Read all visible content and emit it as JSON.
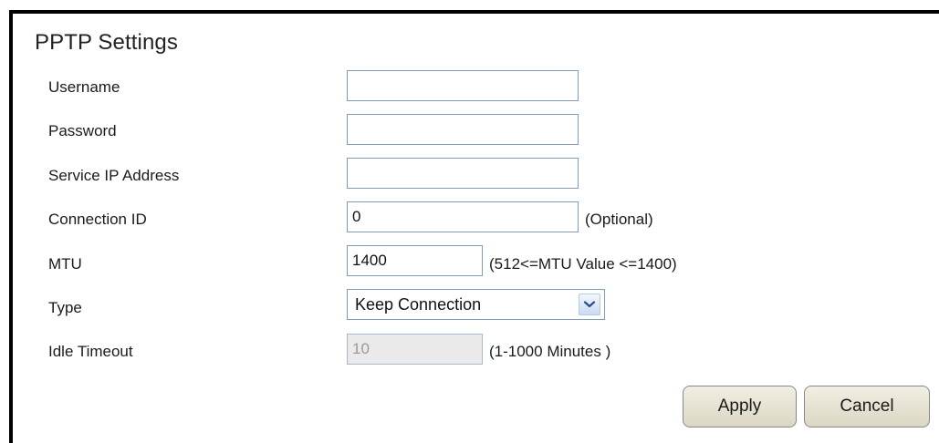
{
  "form": {
    "title": "PPTP Settings",
    "fields": {
      "username": {
        "label": "Username",
        "value": ""
      },
      "password": {
        "label": "Password",
        "value": ""
      },
      "service_ip": {
        "label": "Service IP Address",
        "value": ""
      },
      "connection_id": {
        "label": "Connection ID",
        "value": "0",
        "note": "(Optional)"
      },
      "mtu": {
        "label": "MTU",
        "value": "1400",
        "note": "(512<=MTU Value <=1400)"
      },
      "type": {
        "label": "Type",
        "selected": "Keep Connection"
      },
      "idle_timeout": {
        "label": "Idle Timeout",
        "value": "10",
        "note": "(1-1000 Minutes )",
        "disabled": true
      }
    }
  },
  "buttons": {
    "apply_label": "Apply",
    "cancel_label": "Cancel"
  },
  "colors": {
    "input_border": "#7f9db9",
    "disabled_bg": "#eaeaea",
    "button_bg": "#e6e2d2"
  },
  "icons": {
    "dropdown": "chevron-down-icon"
  }
}
